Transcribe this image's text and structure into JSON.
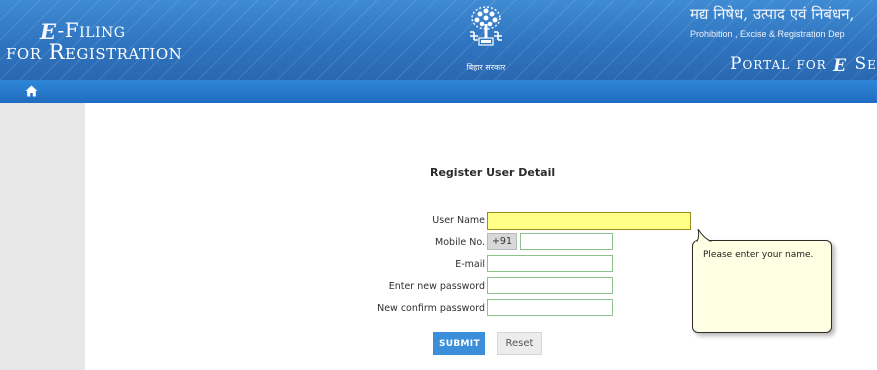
{
  "header": {
    "left_title_line1": "Filing",
    "left_title_line2": "for Registration",
    "e_letter": "e",
    "dash": "-",
    "emblem_caption": "बिहार सरकार",
    "hindi_department": "मद्य निषेध, उत्पाद एवं निबंधन,",
    "department_en": "Prohibition , Excise & Registration Dep",
    "portal_text": "Portal for",
    "portal_tail": "Se"
  },
  "nav": {
    "home_icon": "home-icon"
  },
  "form": {
    "title": "Register User Detail",
    "username_label": "User Name",
    "username_value": "",
    "mobile_label": "Mobile No.",
    "mobile_prefix": "+91",
    "mobile_value": "",
    "email_label": "E-mail",
    "email_value": "",
    "password_label": "Enter new password",
    "password_value": "",
    "confirm_label": "New confirm password",
    "confirm_value": "",
    "submit_label": "SUBMIT",
    "reset_label": "Reset"
  },
  "tooltip": {
    "message": "Please enter your name."
  },
  "colors": {
    "header_blue": "#2f74bf",
    "nav_blue": "#1f6cc0",
    "active_field": "#ffff88",
    "submit_blue": "#3a8fd8",
    "tooltip_bg": "#ffffe3"
  }
}
